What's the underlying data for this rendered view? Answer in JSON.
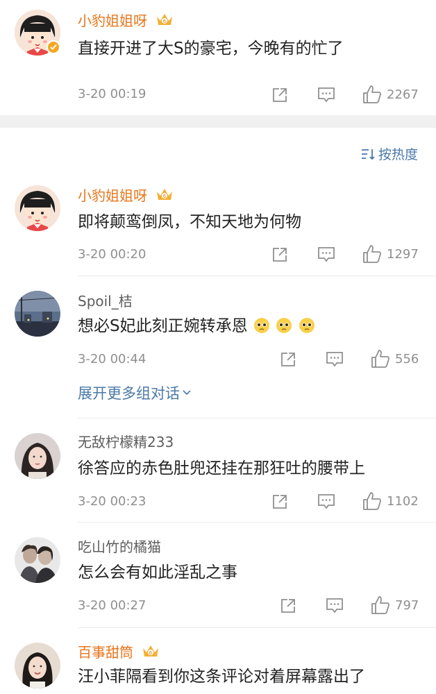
{
  "top_comment": {
    "username": "小豹姐姐呀",
    "text": "直接开进了大S的豪宅，今晚有的忙了",
    "time": "3-20 00:19",
    "likes": "2267",
    "avatar_icon": "cartoon-girl-avatar",
    "verified": true
  },
  "sort": {
    "label": "按热度",
    "icon": "sort-icon"
  },
  "comments": [
    {
      "username": "小豹姐姐呀",
      "text": "即将颠鸾倒凤，不知天地为何物",
      "time": "3-20 00:20",
      "likes": "1297",
      "avatar_icon": "cartoon-girl-avatar"
    },
    {
      "username": "Spoil_桔",
      "text": "想必S妃此刻正婉转承恩",
      "emojis": [
        "pleading-face-emoji",
        "pleading-face-emoji",
        "pleading-face-emoji"
      ],
      "time": "3-20 00:44",
      "likes": "556",
      "avatar_icon": "night-street-photo-avatar",
      "expand_label": "展开更多组对话"
    },
    {
      "username": "无敌柠檬精233",
      "text": "徐答应的赤色肚兜还挂在那狂吐的腰带上",
      "time": "3-20 00:23",
      "likes": "1102",
      "avatar_icon": "portrait-photo-avatar"
    },
    {
      "username": "吃山竹的橘猫",
      "text": "怎么会有如此淫乱之事",
      "time": "3-20 00:27",
      "likes": "797",
      "avatar_icon": "couple-photo-avatar"
    },
    {
      "username": "百事甜筒",
      "text": "汪小菲隔看到你这条评论对着屏幕露出了",
      "avatar_icon": "girl-portrait-avatar"
    }
  ],
  "colors": {
    "vip_name": "#e8751a",
    "link": "#4a78a8",
    "meta": "#8f8f8f",
    "separator": "#f0f0f0"
  }
}
